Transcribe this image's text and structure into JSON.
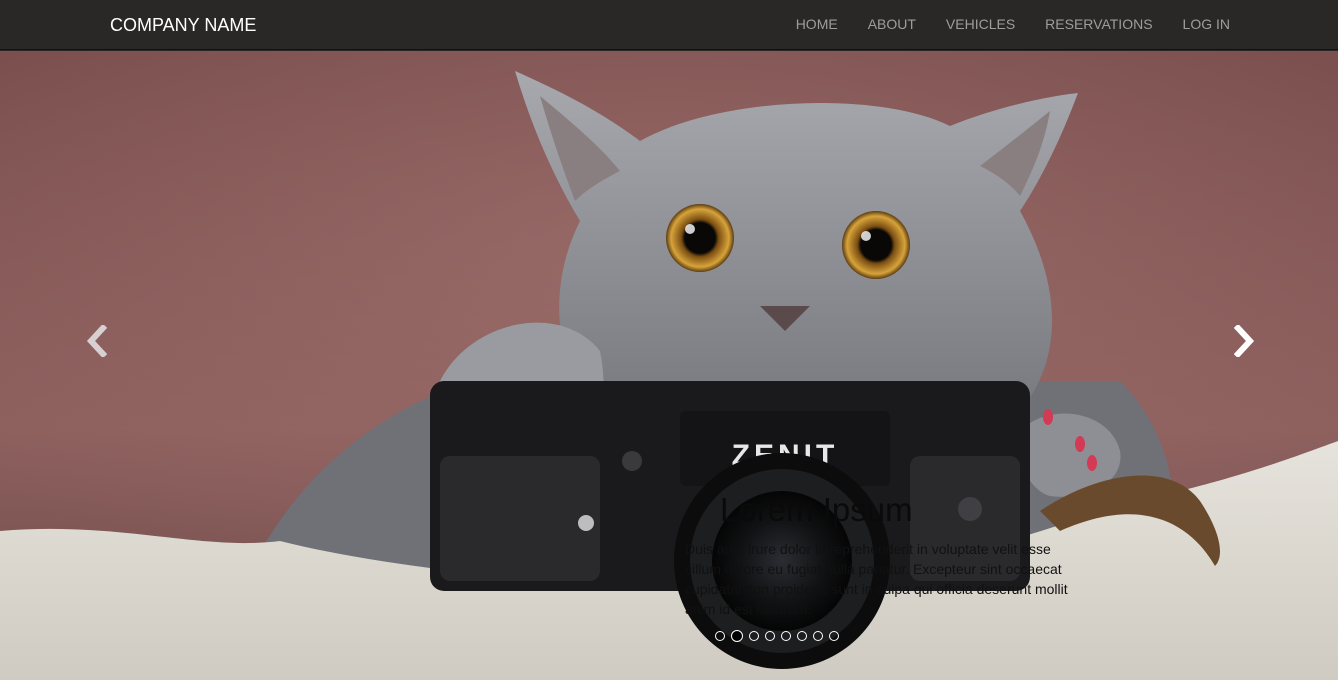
{
  "navbar": {
    "brand": "COMPANY NAME",
    "items": [
      {
        "label": "HOME"
      },
      {
        "label": "ABOUT"
      },
      {
        "label": "VEHICLES"
      },
      {
        "label": "RESERVATIONS"
      },
      {
        "label": "LOG IN"
      }
    ]
  },
  "carousel": {
    "slide_image": "cat-with-zenit-camera",
    "camera_brand_text": "ZENIT",
    "caption": {
      "title": "Lorem Ipsum",
      "text": "Duis aute irure dolor in reprehenderit in voluptate velit esse cillum dolore eu fugiat nulla pariatur. Excepteur sint occaecat cupidatat non proident, sunt in culpa qui officia deserunt mollit anim id est laborum."
    },
    "prev_icon": "chevron-left-icon",
    "next_icon": "chevron-right-icon",
    "indicator_count": 8,
    "active_indicator": 2
  },
  "colors": {
    "navbar_bg": "#2a2827",
    "brand_text": "#ffffff",
    "nav_text": "#9d9d9d",
    "backdrop": "#8a5a58"
  }
}
